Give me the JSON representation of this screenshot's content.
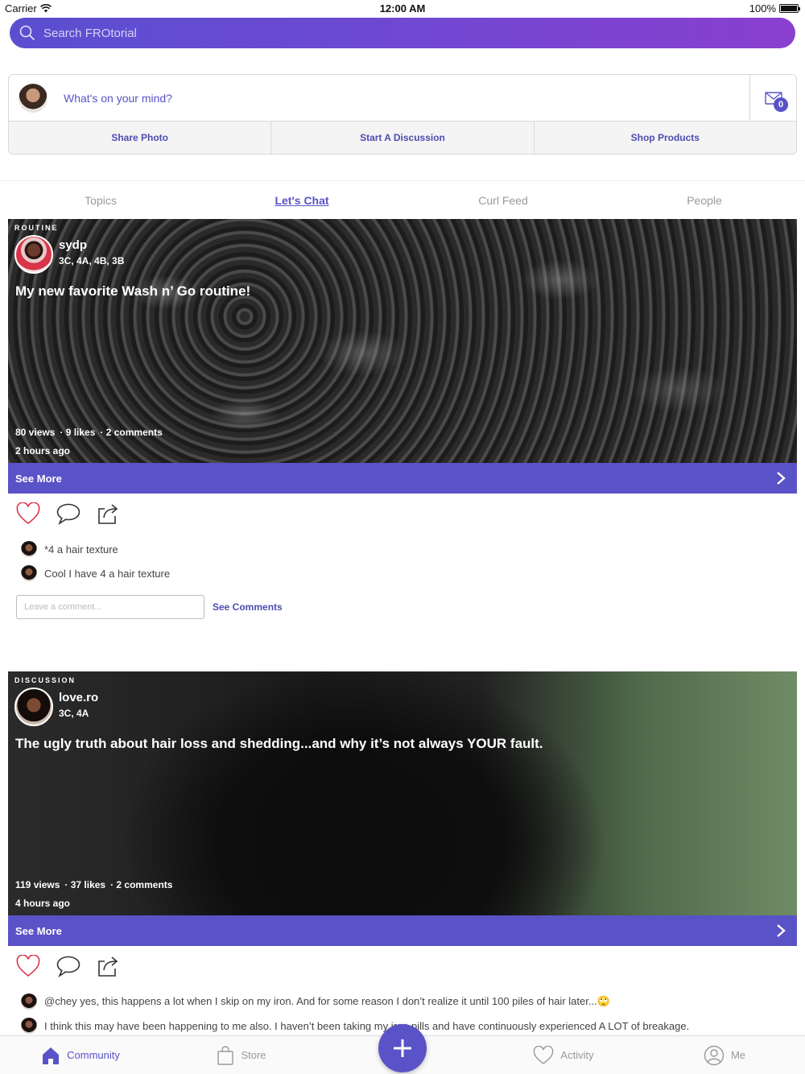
{
  "status_bar": {
    "carrier": "Carrier",
    "time": "12:00 AM",
    "battery": "100%"
  },
  "search": {
    "placeholder": "Search FROtorial"
  },
  "composer": {
    "prompt": "What's on your mind?",
    "inbox_count": "0",
    "actions": [
      "Share Photo",
      "Start A Discussion",
      "Shop Products"
    ]
  },
  "tabs": [
    {
      "label": "Topics",
      "active": false
    },
    {
      "label": "Let's Chat",
      "active": true
    },
    {
      "label": "Curl Feed",
      "active": false
    },
    {
      "label": "People",
      "active": false
    }
  ],
  "posts": [
    {
      "tag": "ROUTINE",
      "username": "sydp",
      "hair_type": "3C, 4A, 4B, 3B",
      "title": "My new favorite Wash n’ Go routine!",
      "views": "80 views",
      "likes": "· 9 likes",
      "comments_count": "· 2 comments",
      "time_ago": "2 hours ago",
      "see_more": "See More",
      "comments": [
        "*4 a hair texture",
        "Cool I have 4 a hair texture"
      ],
      "comment_placeholder": "Leave a comment...",
      "see_comments": "See Comments"
    },
    {
      "tag": "DISCUSSION",
      "username": "love.ro",
      "hair_type": "3C, 4A",
      "title": "The ugly truth about hair loss and shedding...and why it’s not always YOUR fault.",
      "views": "119 views",
      "likes": "· 37 likes",
      "comments_count": "· 2 comments",
      "time_ago": "4 hours ago",
      "see_more": "See More",
      "comments": [
        "@chey yes, this happens a lot when I skip on my iron. And for some reason I don’t realize it until 100 piles of hair later...🙄",
        "I think this may have been happening to me also. I haven’t been taking my iron pills and have continuously experienced A LOT of breakage."
      ]
    }
  ],
  "tab_bar": {
    "community": "Community",
    "store": "Store",
    "center": "on",
    "activity": "Activity",
    "me": "Me"
  },
  "colors": {
    "accent": "#5a52c7",
    "gradient_start": "#5a4fd0",
    "gradient_end": "#8a3fcf",
    "heart": "#e0304a"
  }
}
